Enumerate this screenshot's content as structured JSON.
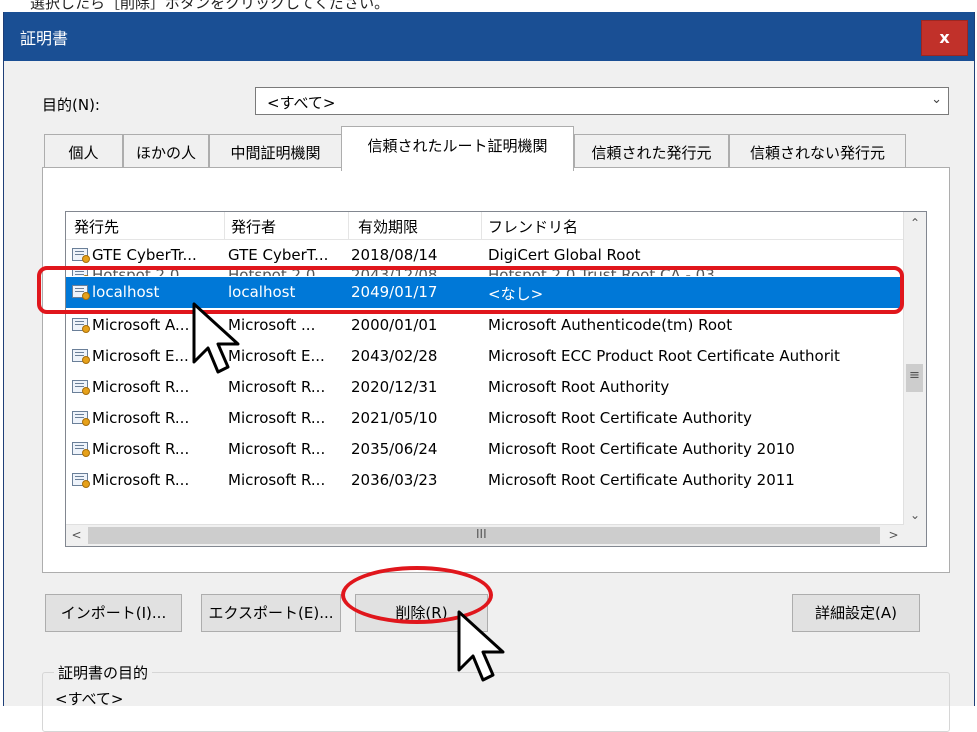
{
  "instruction_text": "選択したら［削除］ボタンをクリックしてください。",
  "window": {
    "title": "証明書",
    "close_label": "x"
  },
  "purpose": {
    "label": "目的(N):",
    "value": "<すべて>"
  },
  "tabs": [
    {
      "label": "個人"
    },
    {
      "label": "ほかの人"
    },
    {
      "label": "中間証明機関"
    },
    {
      "label": "信頼されたルート証明機関",
      "active": true
    },
    {
      "label": "信頼された発行元"
    },
    {
      "label": "信頼されない発行元"
    }
  ],
  "list": {
    "columns": [
      "発行先",
      "発行者",
      "有効期限",
      "フレンドリ名"
    ],
    "rows": [
      {
        "issued_to": "GTE CyberTr...",
        "issued_by": "GTE CyberT...",
        "expires": "2018/08/14",
        "friendly": "DigiCert Global Root"
      },
      {
        "issued_to": "Hotspot 2.0...",
        "issued_by": "Hotspot 2.0...",
        "expires": "2043/12/08",
        "friendly": "Hotspot 2.0 Trust Root CA - 03",
        "partial": true
      },
      {
        "issued_to": "localhost",
        "issued_by": "localhost",
        "expires": "2049/01/17",
        "friendly": "<なし>",
        "selected": true
      },
      {
        "issued_to": "Microsoft A...",
        "issued_by": "Microsoft ...",
        "expires": "2000/01/01",
        "friendly": "Microsoft Authenticode(tm) Root"
      },
      {
        "issued_to": "Microsoft E...",
        "issued_by": "Microsoft E...",
        "expires": "2043/02/28",
        "friendly": "Microsoft ECC Product Root Certificate Authorit"
      },
      {
        "issued_to": "Microsoft R...",
        "issued_by": "Microsoft R...",
        "expires": "2020/12/31",
        "friendly": "Microsoft Root Authority"
      },
      {
        "issued_to": "Microsoft R...",
        "issued_by": "Microsoft R...",
        "expires": "2021/05/10",
        "friendly": "Microsoft Root Certificate Authority"
      },
      {
        "issued_to": "Microsoft R...",
        "issued_by": "Microsoft R...",
        "expires": "2035/06/24",
        "friendly": "Microsoft Root Certificate Authority 2010"
      },
      {
        "issued_to": "Microsoft R...",
        "issued_by": "Microsoft R...",
        "expires": "2036/03/23",
        "friendly": "Microsoft Root Certificate Authority 2011"
      }
    ]
  },
  "buttons": {
    "import": "インポート(I)...",
    "export": "エクスポート(E)...",
    "remove": "削除(R)",
    "advanced": "詳細設定(A)"
  },
  "purposes_group": {
    "title": "証明書の目的",
    "value": "<すべて>"
  },
  "colors": {
    "titlebar": "#1a4f94",
    "close": "#c1312a",
    "selection": "#0078d7",
    "annotation": "#e0161c"
  }
}
